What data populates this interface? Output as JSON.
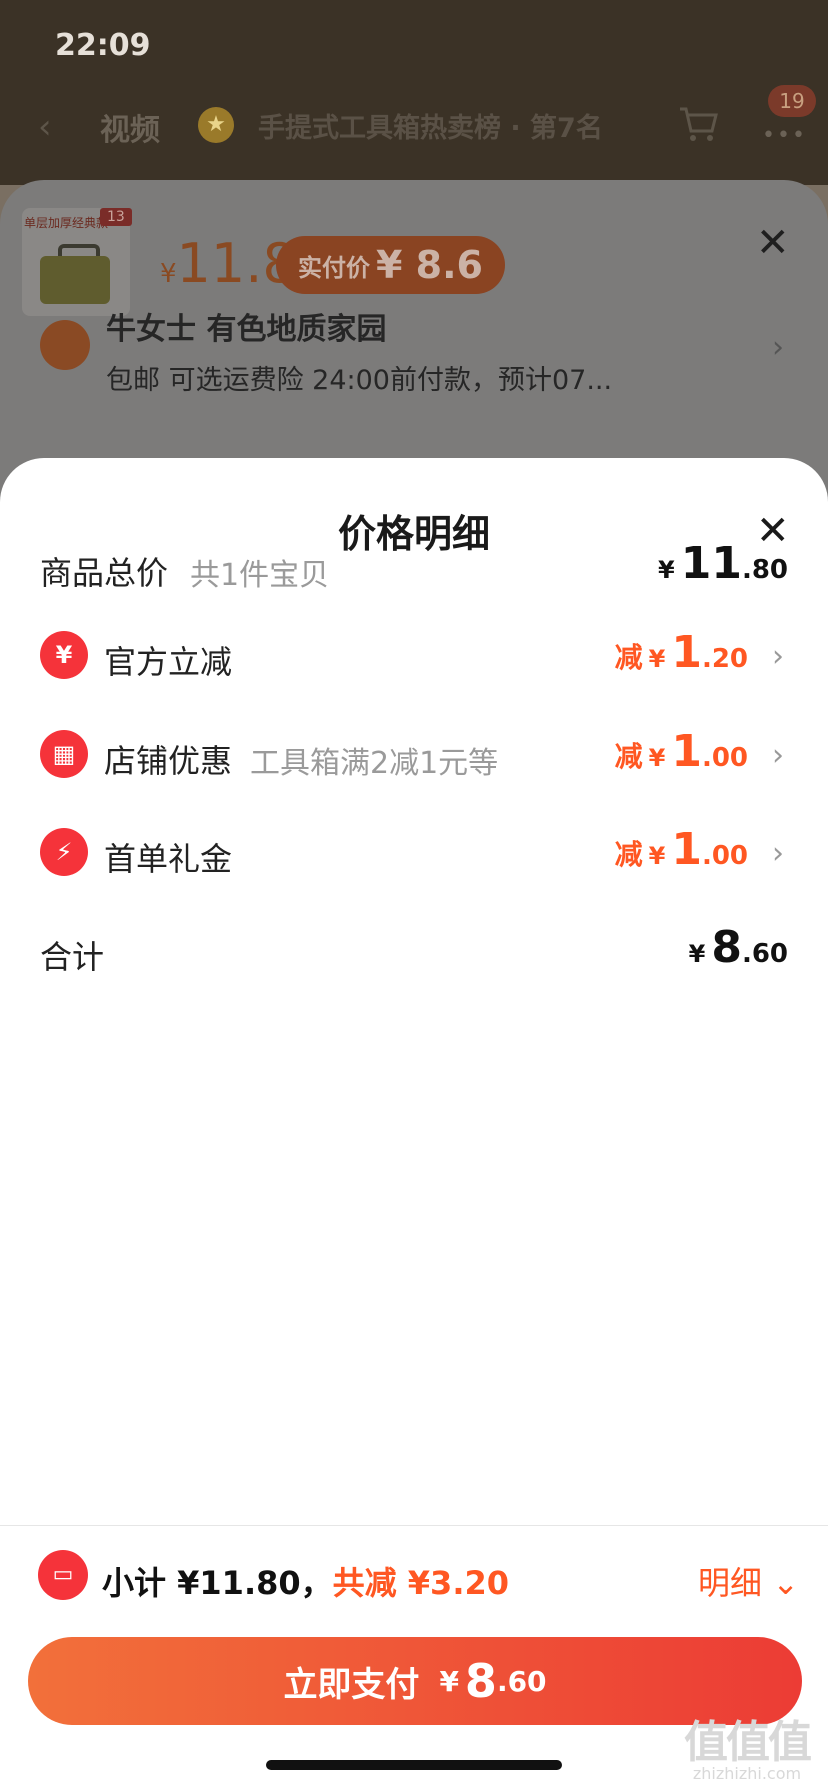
{
  "status_bar": {
    "time": "22:09"
  },
  "top_nav": {
    "back_icon": "chevron-left-icon",
    "tab_video": "视频",
    "rank_text": "手提式工具箱热卖榜 · 第7名",
    "cart_icon": "cart-icon",
    "cart_count": "19",
    "more_icon": "more-dots-icon"
  },
  "product_sheet": {
    "thumb_label": "单层加厚经典款",
    "thumb_badge": "13",
    "price_yen": "¥",
    "price": "11.8",
    "paid_label": "实付价",
    "paid_amount": "¥ 8.6",
    "address_name": "牛女士 有色地质家园",
    "address_detail": "包邮  可选运费险  24:00前付款，预计07..."
  },
  "price_detail": {
    "title": "价格明细",
    "rows": [
      {
        "label": "商品总价",
        "sub": "共1件宝贝",
        "prefix": "",
        "yen": "¥",
        "int": "11",
        "dec": ".80",
        "icon": ""
      },
      {
        "label": "官方立减",
        "sub": "",
        "prefix": "减",
        "yen": "¥",
        "int": "1",
        "dec": ".20",
        "icon": "yen-refund-icon"
      },
      {
        "label": "店铺优惠",
        "sub": "工具箱满2减1元等",
        "prefix": "减",
        "yen": "¥",
        "int": "1",
        "dec": ".00",
        "icon": "store-icon"
      },
      {
        "label": "首单礼金",
        "sub": "",
        "prefix": "减",
        "yen": "¥",
        "int": "1",
        "dec": ".00",
        "icon": "lightning-icon"
      },
      {
        "label": "合计",
        "sub": "",
        "prefix": "",
        "yen": "¥",
        "int": "8",
        "dec": ".60",
        "icon": ""
      }
    ]
  },
  "footer": {
    "subtotal_text": "小计 ¥11.80，",
    "discount_text": "共减 ¥3.20",
    "detail_label": "明细",
    "pay_label": "立即支付",
    "pay_yen": "¥",
    "pay_int": "8",
    "pay_dec": ".60"
  },
  "watermark": {
    "big": "值值值",
    "small": "zhizhizhi.com"
  },
  "colors": {
    "accent": "#ff5722",
    "icon_red": "#f5333a",
    "pay_start": "#f2703a",
    "pay_end": "#ec3c35"
  }
}
